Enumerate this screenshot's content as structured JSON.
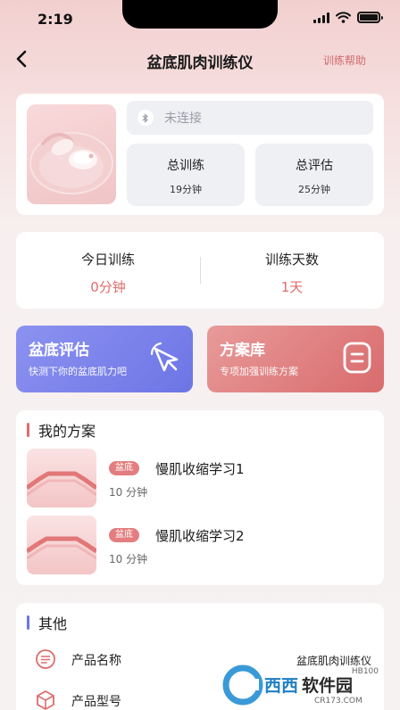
{
  "status_bar": {
    "time": "2:19"
  },
  "nav": {
    "title": "盆底肌肉训练仪",
    "help": "训练帮助"
  },
  "device": {
    "connection": "未连接",
    "stats": [
      {
        "label": "总训练",
        "value": "19分钟"
      },
      {
        "label": "总评估",
        "value": "25分钟"
      }
    ]
  },
  "today": [
    {
      "label": "今日训练",
      "value": "0分钟"
    },
    {
      "label": "训练天数",
      "value": "1天"
    }
  ],
  "tiles": {
    "assess": {
      "title": "盆底评估",
      "subtitle": "快测下你的盆底肌力吧",
      "icon": "cursor-arrow-icon"
    },
    "plans": {
      "title": "方案库",
      "subtitle": "专项加强训练方案",
      "icon": "document-icon"
    }
  },
  "my_plans": {
    "title": "我的方案",
    "items": [
      {
        "tag": "盆底",
        "name": "慢肌收缩学习1",
        "duration": "10 分钟"
      },
      {
        "tag": "盆底",
        "name": "慢肌收缩学习2",
        "duration": "10 分钟"
      }
    ]
  },
  "other": {
    "title": "其他",
    "rows": [
      {
        "label": "产品名称",
        "value": "盆底肌肉训练仪",
        "icon": "list-circle-icon"
      },
      {
        "label": "产品型号",
        "value": "",
        "icon": "box-icon"
      }
    ]
  },
  "watermark": {
    "brand": "西西软件园",
    "url": "CR173.COM",
    "code": "HB100"
  },
  "colors": {
    "accent": "#e06c6c",
    "assess_tile": "#7a80ea",
    "plans_tile": "#de7b7d",
    "section_bar_plans": "#e06c6c",
    "section_bar_other": "#6d75e6"
  }
}
